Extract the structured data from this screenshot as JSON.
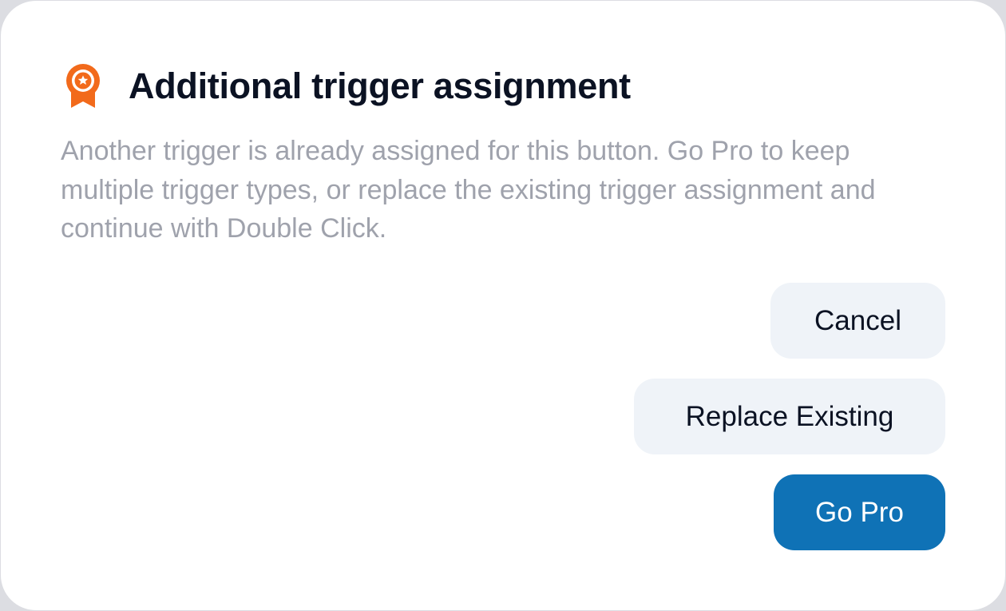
{
  "dialog": {
    "icon": "award-ribbon-icon",
    "accent_color": "#f26a1b",
    "title": "Additional trigger assignment",
    "message": "Another trigger is already assigned for this button. Go Pro to keep multiple trigger types, or replace the existing trigger assignment and continue with Double Click.",
    "buttons": {
      "cancel_label": "Cancel",
      "replace_label": "Replace Existing",
      "go_pro_label": "Go Pro",
      "primary_color": "#0f72b6",
      "secondary_color": "#eff3f8"
    }
  }
}
